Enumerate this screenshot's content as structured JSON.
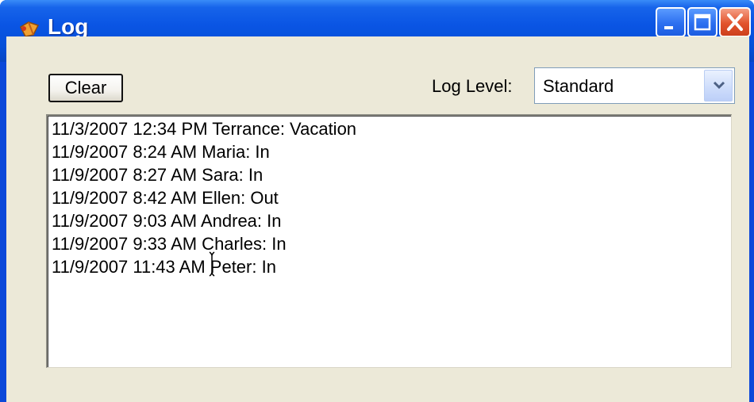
{
  "window": {
    "title": "Log",
    "controls": {
      "minimize": "minimize-icon",
      "maximize": "maximize-icon",
      "close": "close-icon"
    }
  },
  "toolbar": {
    "clear_label": "Clear",
    "log_level_label": "Log Level:",
    "log_level_value": "Standard"
  },
  "log": {
    "entries": [
      "11/3/2007 12:34 PM Terrance: Vacation",
      "11/9/2007 8:24 AM Maria: In",
      "11/9/2007 8:27 AM Sara: In",
      "11/9/2007 8:42 AM Ellen: Out",
      "11/9/2007 9:03 AM Andrea: In",
      "11/9/2007 9:33 AM Charles: In",
      "11/9/2007 11:43 AM Peter: In"
    ]
  },
  "colors": {
    "titlebar": "#0a55e4",
    "client": "#ece9d8",
    "close_button": "#e2532c"
  }
}
